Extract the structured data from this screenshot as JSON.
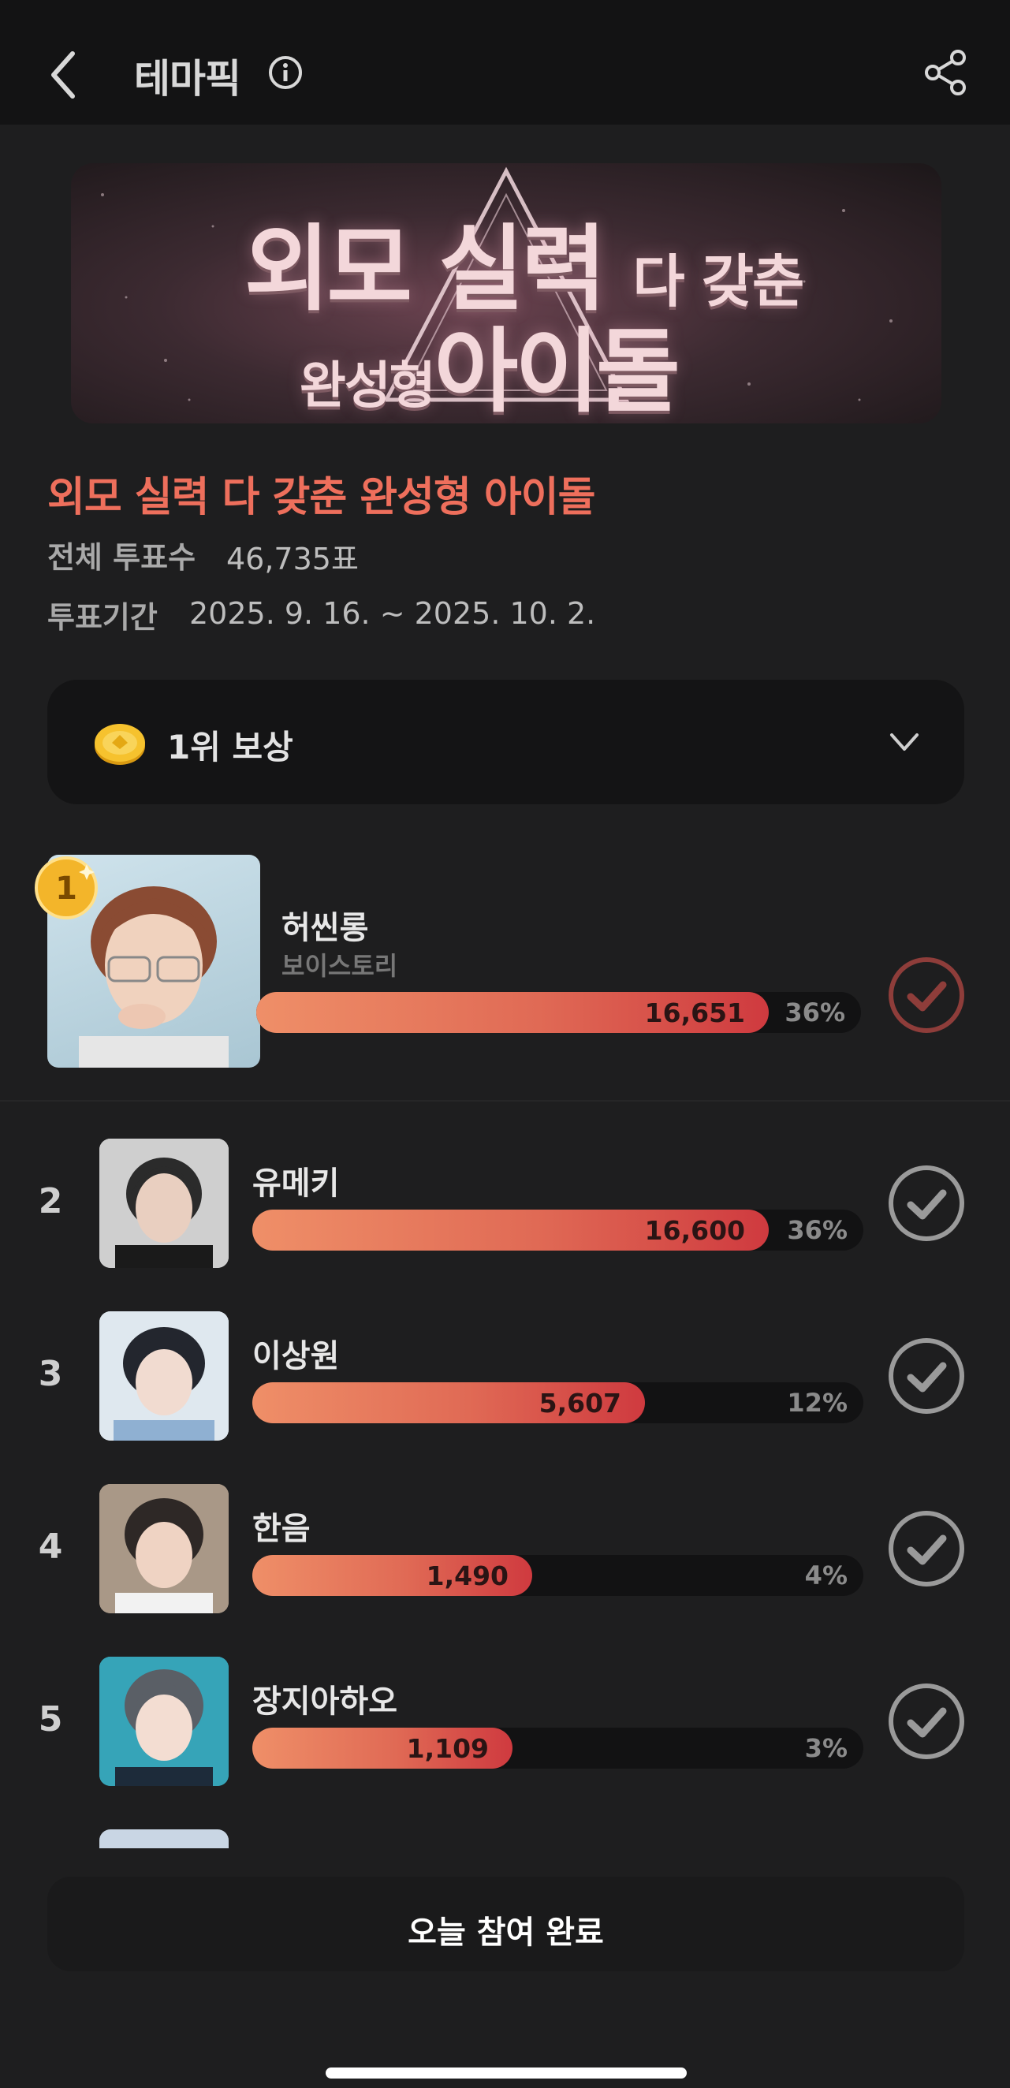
{
  "header": {
    "title": "테마픽",
    "info_icon": "info-icon",
    "share_icon": "share-icon",
    "back_icon": "chevron-left-icon"
  },
  "banner": {
    "line1_big": "외모 실력",
    "line1_small": "다 갖춘",
    "line2_small": "완성형",
    "line2_big": "아이돌"
  },
  "poll": {
    "title": "외모 실력 다 갖춘 완성형 아이돌",
    "total_label": "전체 투표수",
    "total_value": "46,735표",
    "period_label": "투표기간",
    "period_value": "2025. 9. 16. ~ 2025. 10. 2."
  },
  "reward": {
    "label": "1위 보상",
    "icon": "coin-icon"
  },
  "colors": {
    "accent": "#ee6f5c",
    "bar_start": "#ef8f68",
    "bar_end": "#cf3a3f",
    "background": "#1e1e1f"
  },
  "candidates": [
    {
      "rank": "1",
      "name": "허씬롱",
      "group": "보이스토리",
      "votes": "16,651",
      "percent": "36%",
      "share": 0.36
    },
    {
      "rank": "2",
      "name": "유메키",
      "votes": "16,600",
      "percent": "36%",
      "share": 0.36
    },
    {
      "rank": "3",
      "name": "이상원",
      "votes": "5,607",
      "percent": "12%",
      "share": 0.12
    },
    {
      "rank": "4",
      "name": "한음",
      "votes": "1,490",
      "percent": "4%",
      "share": 0.04
    },
    {
      "rank": "5",
      "name": "장지아하오",
      "votes": "1,109",
      "percent": "3%",
      "share": 0.03
    }
  ],
  "footer": {
    "done_label": "오늘 참여 완료"
  }
}
